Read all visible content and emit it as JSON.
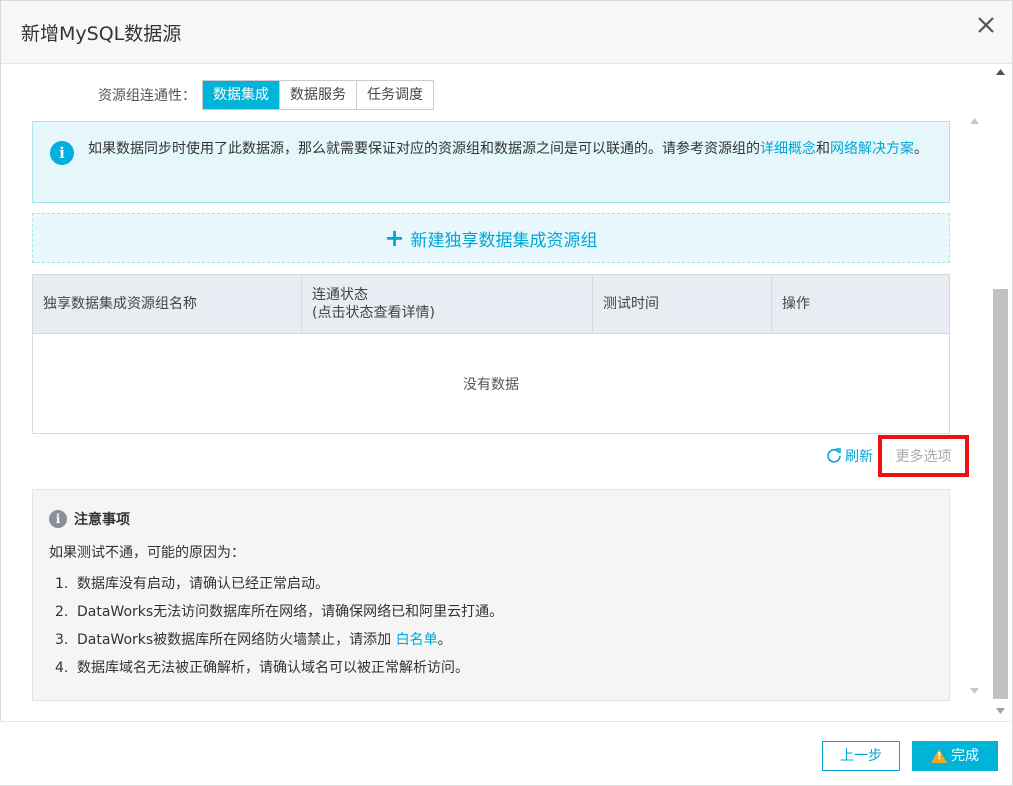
{
  "dialog": {
    "title": "新增MySQL数据源"
  },
  "connectivity": {
    "label": "资源组连通性：",
    "tabs": [
      {
        "label": "数据集成",
        "active": true
      },
      {
        "label": "数据服务",
        "active": false
      },
      {
        "label": "任务调度",
        "active": false
      }
    ]
  },
  "info": {
    "text_before": "如果数据同步时使用了此数据源，那么就需要保证对应的资源组和数据源之间是可以联通的。请参考资源组的",
    "link1": "详细概念",
    "and": "和",
    "link2": "网络解决方案",
    "period": "。"
  },
  "new_group": {
    "label": "新建独享数据集成资源组"
  },
  "table": {
    "columns": [
      {
        "line1": "独享数据集成资源组名称",
        "line2": ""
      },
      {
        "line1": "连通状态",
        "line2": "(点击状态查看详情)"
      },
      {
        "line1": "测试时间",
        "line2": ""
      },
      {
        "line1": "操作",
        "line2": ""
      }
    ],
    "empty_text": "没有数据"
  },
  "actions": {
    "refresh": "刷新",
    "more_options": "更多选项"
  },
  "notice": {
    "title": "注意事项",
    "intro": "如果测试不通，可能的原因为：",
    "items": [
      {
        "num": "1.",
        "text": "数据库没有启动，请确认已经正常启动。",
        "link": "",
        "suffix": ""
      },
      {
        "num": "2.",
        "text": "DataWorks无法访问数据库所在网络，请确保网络已和阿里云打通。",
        "link": "",
        "suffix": ""
      },
      {
        "num": "3.",
        "text": "DataWorks被数据库所在网络防火墙禁止，请添加 ",
        "link": "白名单",
        "suffix": "。"
      },
      {
        "num": "4.",
        "text": "数据库域名无法被正确解析，请确认域名可以被正常解析访问。",
        "link": "",
        "suffix": ""
      }
    ]
  },
  "footer": {
    "prev": "上一步",
    "done": "完成"
  },
  "colors": {
    "accent": "#00b4d8",
    "link": "#00a6d6",
    "highlight_border": "#ee1111",
    "warning": "#f5a623"
  }
}
